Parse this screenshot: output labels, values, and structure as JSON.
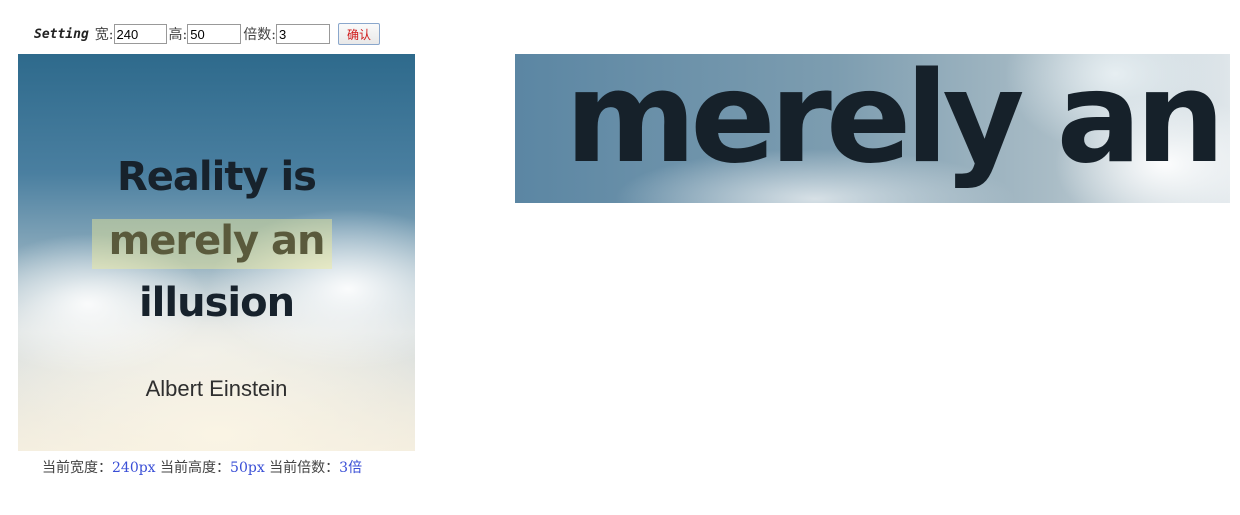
{
  "settings": {
    "brand_label": "Setting",
    "width_label": "宽:",
    "width_value": "240",
    "height_label": "高:",
    "height_value": "50",
    "multiplier_label": "倍数:",
    "multiplier_value": "3",
    "confirm_label": "确认"
  },
  "source_image": {
    "line1": "Reality is",
    "line2": "merely an",
    "line3": "illusion",
    "author": "Albert Einstein"
  },
  "status": {
    "width_label": "当前宽度：",
    "width_value": "240px",
    "height_label": " 当前高度：",
    "height_value": "50px",
    "multiplier_label": " 当前倍数：",
    "multiplier_value": "3倍"
  },
  "preview": {
    "text": "merely an"
  },
  "colors": {
    "status_value": "#3a4fd6",
    "confirm_text": "#d01818",
    "quote_text": "#17222c",
    "selection_highlight": "#f0eb96"
  }
}
